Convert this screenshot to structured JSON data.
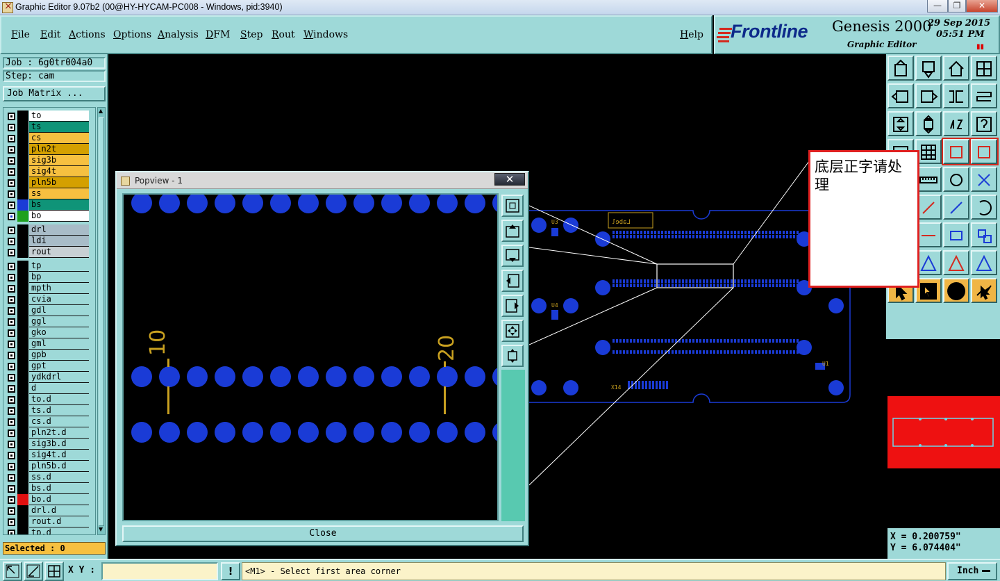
{
  "window": {
    "title": "Graphic Editor 9.07b2 (00@HY-HYCAM-PC008 - Windows, pid:3940)",
    "minimize": "—",
    "maximize": "❐",
    "close": "✕"
  },
  "menu": {
    "items": [
      "File",
      "Edit",
      "Actions",
      "Options",
      "Analysis",
      "DFM",
      "Step",
      "Rout",
      "Windows"
    ],
    "help": "Help"
  },
  "brand": {
    "logo": "Frontline",
    "product": "Genesis 2000",
    "subtitle": "Graphic Editor",
    "date": "29 Sep 2015",
    "time": "05:51 PM"
  },
  "job": {
    "job_label": "Job : 6g0tr004a0",
    "step_label": "Step: cam",
    "matrix_button": "Job Matrix ..."
  },
  "layers": [
    {
      "name": "to",
      "bg": "#ffffff",
      "swatch": "#000000"
    },
    {
      "name": "ts",
      "bg": "#0f9478",
      "swatch": "#000000"
    },
    {
      "name": "cs",
      "bg": "#f6c040",
      "swatch": "#000000"
    },
    {
      "name": "pln2t",
      "bg": "#d4a000",
      "swatch": "#000000"
    },
    {
      "name": "sig3b",
      "bg": "#f6c040",
      "swatch": "#000000"
    },
    {
      "name": "sig4t",
      "bg": "#f6c040",
      "swatch": "#000000"
    },
    {
      "name": "pln5b",
      "bg": "#d4a000",
      "swatch": "#000000"
    },
    {
      "name": "ss",
      "bg": "#f6c040",
      "swatch": "#000000"
    },
    {
      "name": "bs",
      "bg": "#0f9478",
      "swatch": "#1a3bd6"
    },
    {
      "name": "bo",
      "bg": "#ffffff",
      "swatch": "#1fa01f"
    },
    {
      "sep": true
    },
    {
      "name": "drl",
      "bg": "#a8bcc8",
      "swatch": "#000000"
    },
    {
      "name": "ldi",
      "bg": "#a8bcc8",
      "swatch": "#000000"
    },
    {
      "name": "rout",
      "bg": "#c8d0d4",
      "swatch": "#000000"
    },
    {
      "sep": true
    },
    {
      "name": "tp",
      "bg": "#9ed9d8",
      "swatch": "#000000"
    },
    {
      "name": "bp",
      "bg": "#9ed9d8",
      "swatch": "#000000"
    },
    {
      "name": "mpth",
      "bg": "#9ed9d8",
      "swatch": "#000000"
    },
    {
      "name": "cvia",
      "bg": "#9ed9d8",
      "swatch": "#000000"
    },
    {
      "name": "gdl",
      "bg": "#9ed9d8",
      "swatch": "#000000"
    },
    {
      "name": "ggl",
      "bg": "#9ed9d8",
      "swatch": "#000000"
    },
    {
      "name": "gko",
      "bg": "#9ed9d8",
      "swatch": "#000000"
    },
    {
      "name": "gml",
      "bg": "#9ed9d8",
      "swatch": "#000000"
    },
    {
      "name": "gpb",
      "bg": "#9ed9d8",
      "swatch": "#000000"
    },
    {
      "name": "gpt",
      "bg": "#9ed9d8",
      "swatch": "#000000"
    },
    {
      "name": "ydkdrl",
      "bg": "#9ed9d8",
      "swatch": "#000000"
    },
    {
      "name": "d",
      "bg": "#9ed9d8",
      "swatch": "#000000"
    },
    {
      "name": "to.d",
      "bg": "#9ed9d8",
      "swatch": "#000000"
    },
    {
      "name": "ts.d",
      "bg": "#9ed9d8",
      "swatch": "#000000"
    },
    {
      "name": "cs.d",
      "bg": "#9ed9d8",
      "swatch": "#000000"
    },
    {
      "name": "pln2t.d",
      "bg": "#9ed9d8",
      "swatch": "#000000"
    },
    {
      "name": "sig3b.d",
      "bg": "#9ed9d8",
      "swatch": "#000000"
    },
    {
      "name": "sig4t.d",
      "bg": "#9ed9d8",
      "swatch": "#000000"
    },
    {
      "name": "pln5b.d",
      "bg": "#9ed9d8",
      "swatch": "#000000"
    },
    {
      "name": "ss.d",
      "bg": "#9ed9d8",
      "swatch": "#000000"
    },
    {
      "name": "bs.d",
      "bg": "#9ed9d8",
      "swatch": "#000000"
    },
    {
      "name": "bo.d",
      "bg": "#9ed9d8",
      "swatch": "#e01010"
    },
    {
      "name": "drl.d",
      "bg": "#9ed9d8",
      "swatch": "#000000"
    },
    {
      "name": "rout.d",
      "bg": "#9ed9d8",
      "swatch": "#000000"
    },
    {
      "name": "tp.d",
      "bg": "#9ed9d8",
      "swatch": "#000000"
    }
  ],
  "selected": "Selected : 0",
  "popview": {
    "title": "Popview - 1",
    "close_button": "Close",
    "labels": [
      "10",
      "20"
    ]
  },
  "note": {
    "text": "底层正字请处理"
  },
  "board": {
    "labels": [
      "U3",
      "U4",
      "U1",
      "U6",
      "X14",
      "Label"
    ]
  },
  "coords": {
    "x": "X = 0.200759\"",
    "y": "Y = 6.074404\""
  },
  "statusbar": {
    "xy_label": "X Y :",
    "xy_value": "",
    "warn": "!",
    "prompt": "<M1> - Select first area corner",
    "units": "Inch"
  },
  "colors": {
    "panel": "#9ed9d8",
    "pad": "#1a3bd6",
    "label": "#c8a020",
    "note_border": "#e02020"
  }
}
